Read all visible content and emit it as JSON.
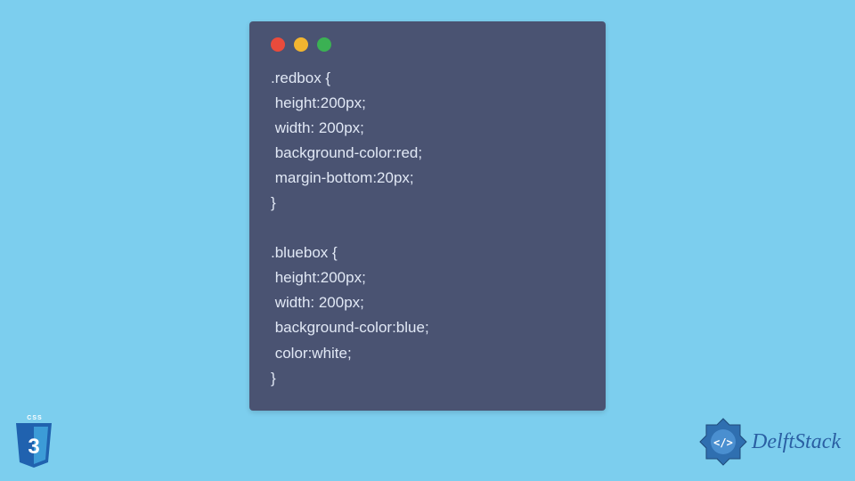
{
  "code_window": {
    "traffic_lights": [
      "red",
      "yellow",
      "green"
    ],
    "code": ".redbox {\n height:200px;\n width: 200px;\n background-color:red;\n margin-bottom:20px;\n}\n\n.bluebox {\n height:200px;\n width: 200px;\n background-color:blue;\n color:white;\n}"
  },
  "css_badge": {
    "label": "CSS",
    "version": "3"
  },
  "brand": {
    "name": "DelftStack"
  },
  "colors": {
    "page_bg": "#7cceee",
    "window_bg": "#4a5372",
    "code_text": "#e1e8f5",
    "css_shield": "#2062af",
    "brand_blue": "#2a5fa3"
  }
}
